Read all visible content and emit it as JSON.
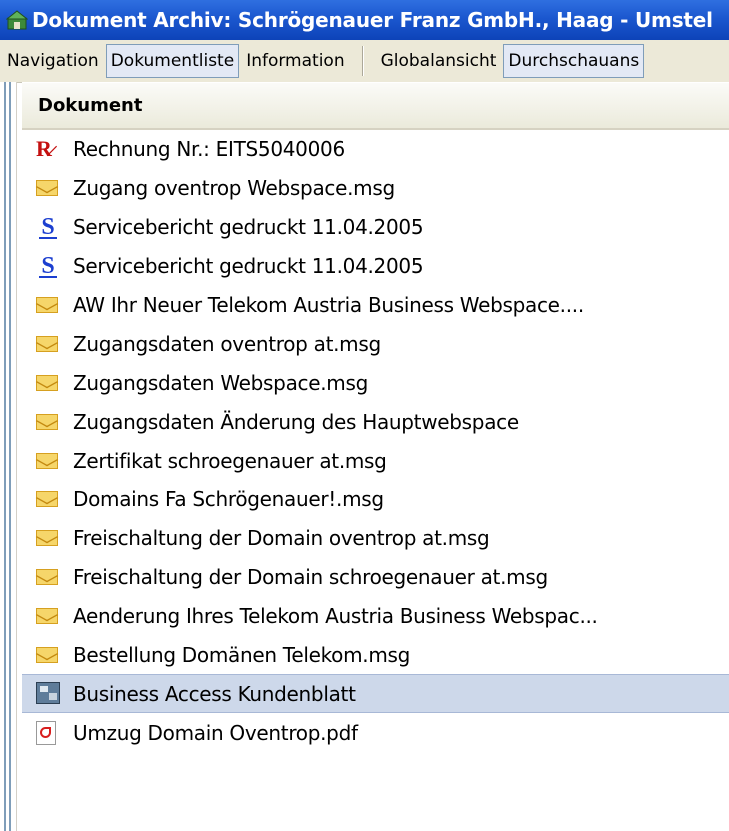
{
  "window": {
    "title": "Dokument Archiv: Schrögenauer Franz GmbH., Haag - Umstel"
  },
  "toolbar": {
    "navigation": "Navigation",
    "dokumentliste": "Dokumentliste",
    "information": "Information",
    "globalansicht": "Globalansicht",
    "durchschauansicht": "Durchschauans"
  },
  "list": {
    "column_header": "Dokument",
    "items": [
      {
        "icon": "invoice-icon",
        "label": "Rechnung Nr.: EITS5040006"
      },
      {
        "icon": "email-icon",
        "label": "Zugang oventrop Webspace.msg"
      },
      {
        "icon": "service-report-icon",
        "label": "Servicebericht gedruckt 11.04.2005"
      },
      {
        "icon": "service-report-icon",
        "label": "Servicebericht gedruckt 11.04.2005"
      },
      {
        "icon": "email-icon",
        "label": "AW  Ihr Neuer Telekom Austria Business Webspace...."
      },
      {
        "icon": "email-icon",
        "label": "Zugangsdaten oventrop at.msg"
      },
      {
        "icon": "email-icon",
        "label": "Zugangsdaten Webspace.msg"
      },
      {
        "icon": "email-icon",
        "label": "Zugangsdaten Änderung des Hauptwebspace"
      },
      {
        "icon": "email-icon",
        "label": "Zertifikat  schroegenauer at.msg"
      },
      {
        "icon": "email-icon",
        "label": "Domains Fa  Schrögenauer!.msg"
      },
      {
        "icon": "email-icon",
        "label": "Freischaltung der Domain oventrop at.msg"
      },
      {
        "icon": "email-icon",
        "label": "Freischaltung der Domain schroegenauer at.msg"
      },
      {
        "icon": "email-icon",
        "label": "Aenderung Ihres Telekom Austria Business Webspac..."
      },
      {
        "icon": "email-icon",
        "label": "Bestellung Domänen Telekom.msg"
      },
      {
        "icon": "business-form-icon",
        "label": "Business Access Kundenblatt"
      },
      {
        "icon": "pdf-icon",
        "label": "Umzug Domain Oventrop.pdf"
      }
    ],
    "selected_index": 14
  },
  "colors": {
    "titlebar": "#1b57cf",
    "selection": "#cdd8ea",
    "toolbar_bg": "#ece9d8"
  }
}
